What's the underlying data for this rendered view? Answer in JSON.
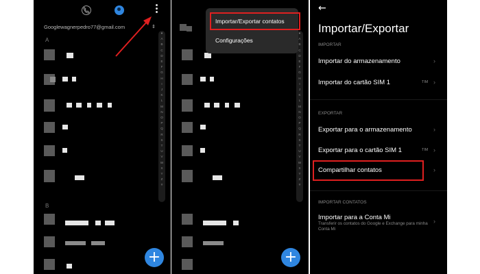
{
  "contacts_list": {
    "account_email": "Googlewagnerpedro77@gmail.com",
    "sections": [
      "A",
      "B"
    ],
    "alphabet": [
      "♥",
      "A",
      "B",
      "C",
      "D",
      "E",
      "F",
      "G",
      "H",
      "I",
      "J",
      "K",
      "L",
      "M",
      "N",
      "O",
      "P",
      "Q",
      "R",
      "S",
      "T",
      "U",
      "V",
      "W",
      "X",
      "Y",
      "Z",
      "#"
    ],
    "fab_label": "+"
  },
  "overflow_menu": {
    "items": [
      "Importar/Exportar contatos",
      "Configurações"
    ]
  },
  "import_export": {
    "back_glyph": "←",
    "title": "Importar/Exportar",
    "import_section": "IMPORTAR",
    "import_items": [
      "Importar do armazenamento",
      "Importar do cartão SIM 1"
    ],
    "export_section": "EXPORTAR",
    "export_items": [
      "Exportar para o armazenamento",
      "Exportar para o cartão SIM 1",
      "Compartilhar contatos"
    ],
    "sim_tag": "TIM",
    "import_contacts_section": "IMPORTAR CONTATOS",
    "mi_item": "Importar para a Conta Mi",
    "mi_subtitle": "Transferir os contatos do Google e Exchange para minha Conta Mi",
    "chevron": "›"
  },
  "colors": {
    "accent": "#2f86e0",
    "highlight": "#e02020",
    "background": "#000000"
  }
}
